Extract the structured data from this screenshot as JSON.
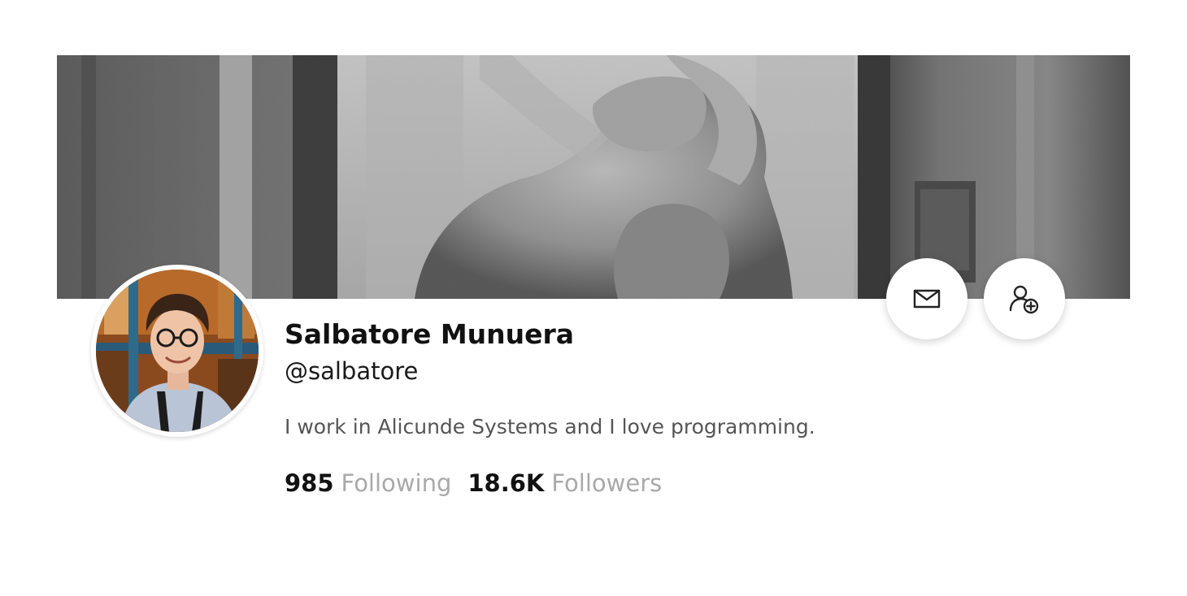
{
  "profile": {
    "name": "Salbatore Munuera",
    "handle": "@salbatore",
    "bio": "I work in Alicunde Systems and I love programming.",
    "stats": {
      "following": {
        "count": "985",
        "label": "Following"
      },
      "followers": {
        "count": "18.6K",
        "label": "Followers"
      }
    }
  },
  "images": {
    "banner": "sculpture-banner",
    "avatar": "profile-photo"
  },
  "actions": {
    "message_icon": "envelope-icon",
    "follow_icon": "add-user-icon"
  },
  "colors": {
    "name": "#111111",
    "bio": "#555555",
    "stat_label": "#a9a9a9"
  }
}
